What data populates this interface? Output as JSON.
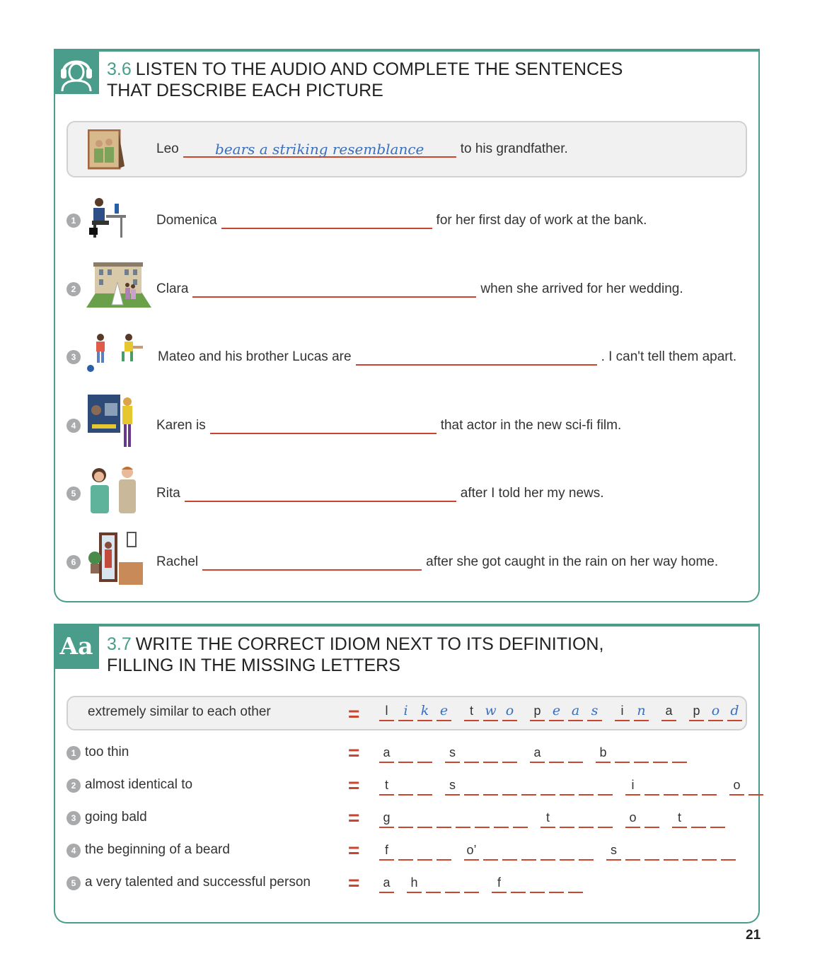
{
  "ex36": {
    "number": "3.6",
    "title": "LISTEN TO THE AUDIO AND COMPLETE THE SENTENCES THAT DESCRIBE EACH PICTURE",
    "icon": "headphones-person-icon",
    "example": {
      "before": "Leo",
      "answer": "bears a striking resemblance",
      "after": "to his grandfather."
    },
    "items": [
      {
        "num": "1",
        "before": "Domenica",
        "after": "for her first day of work at the bank."
      },
      {
        "num": "2",
        "before": "Clara",
        "after": "when she arrived for her wedding."
      },
      {
        "num": "3",
        "before": "Mateo and his brother Lucas are",
        "after": ". I can't tell them apart."
      },
      {
        "num": "4",
        "before": "Karen is",
        "after": "that actor in the new sci-fi film."
      },
      {
        "num": "5",
        "before": "Rita",
        "after": "after I told her my news."
      },
      {
        "num": "6",
        "before": "Rachel",
        "after": "after she got caught in the rain on her way home."
      }
    ]
  },
  "ex37": {
    "number": "3.7",
    "title": "WRITE THE CORRECT IDIOM NEXT TO ITS DEFINITION, FILLING IN THE MISSING LETTERS",
    "badge": "Aa",
    "equals": "=",
    "example": {
      "definition": "extremely similar to each other",
      "words": [
        [
          {
            "t": "l",
            "f": false
          },
          {
            "t": "i",
            "f": true
          },
          {
            "t": "k",
            "f": true
          },
          {
            "t": "e",
            "f": true
          }
        ],
        [
          {
            "t": "t",
            "f": false
          },
          {
            "t": "w",
            "f": true
          },
          {
            "t": "o",
            "f": true
          }
        ],
        [
          {
            "t": "p",
            "f": false
          },
          {
            "t": "e",
            "f": true
          },
          {
            "t": "a",
            "f": true
          },
          {
            "t": "s",
            "f": true
          }
        ],
        [
          {
            "t": "i",
            "f": false
          },
          {
            "t": "n",
            "f": true
          }
        ],
        [
          {
            "t": "a",
            "f": false
          }
        ],
        [
          {
            "t": "p",
            "f": false
          },
          {
            "t": "o",
            "f": true
          },
          {
            "t": "d",
            "f": true
          }
        ]
      ]
    },
    "items": [
      {
        "num": "1",
        "definition": "too thin",
        "words": [
          [
            "a",
            "",
            ""
          ],
          [
            "s",
            "",
            "",
            ""
          ],
          [
            "a",
            "",
            ""
          ],
          [
            "b",
            "",
            "",
            "",
            ""
          ]
        ]
      },
      {
        "num": "2",
        "definition": "almost identical to",
        "words": [
          [
            "t",
            "",
            ""
          ],
          [
            "s",
            "",
            "",
            "",
            "",
            "",
            "",
            "",
            ""
          ],
          [
            "i",
            "",
            "",
            "",
            ""
          ],
          [
            "o",
            ""
          ]
        ]
      },
      {
        "num": "3",
        "definition": "going bald",
        "words": [
          [
            "g",
            "",
            "",
            "",
            "",
            "",
            "",
            ""
          ],
          [
            "t",
            "",
            "",
            ""
          ],
          [
            "o",
            ""
          ],
          [
            "t",
            "",
            ""
          ]
        ]
      },
      {
        "num": "4",
        "definition": "the beginning of a beard",
        "words": [
          [
            "f",
            "",
            "",
            ""
          ],
          [
            "o’",
            "",
            "",
            "",
            "",
            "",
            ""
          ],
          [
            "s",
            "",
            "",
            "",
            "",
            "",
            ""
          ]
        ]
      },
      {
        "num": "5",
        "definition": "a very talented and successful person",
        "words": [
          [
            "a"
          ],
          [
            "h",
            "",
            "",
            ""
          ],
          [
            "f",
            "",
            "",
            "",
            ""
          ]
        ]
      }
    ]
  },
  "page_number": "21"
}
